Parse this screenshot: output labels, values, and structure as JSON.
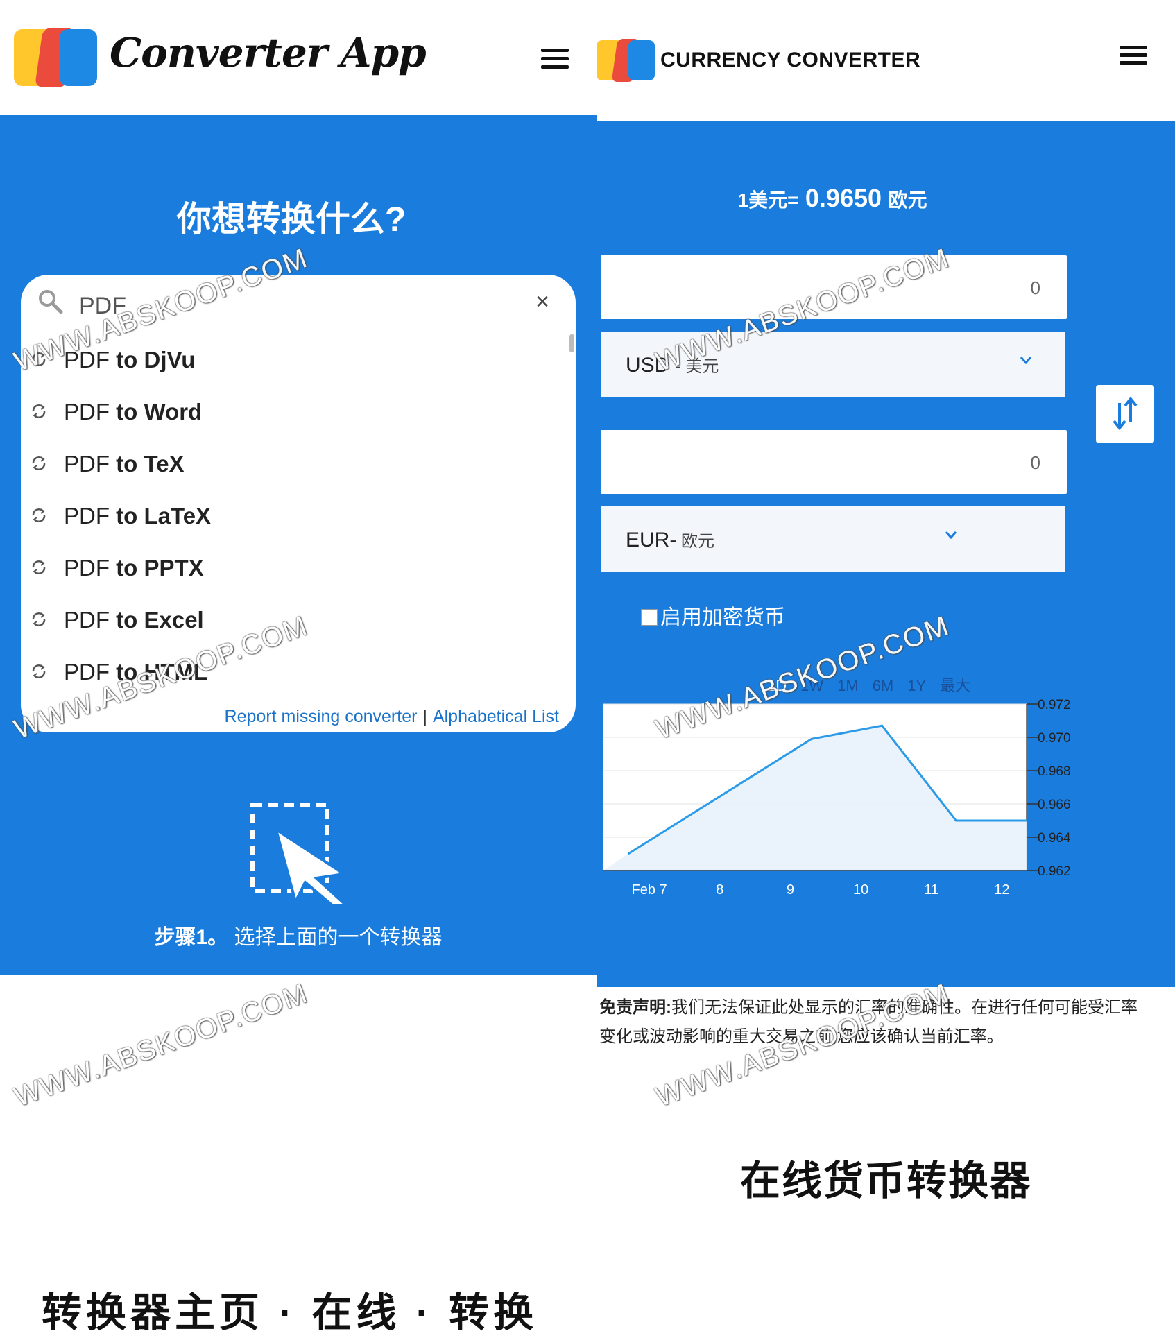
{
  "left_panel": {
    "brand": "Converter App",
    "question": "你想转换什么?",
    "search": {
      "value": "PDF",
      "clear_symbol": "×"
    },
    "results": [
      {
        "source": "PDF ",
        "target": "to DjVu"
      },
      {
        "source": "PDF ",
        "target": "to Word"
      },
      {
        "source": "PDF ",
        "target": "to TeX"
      },
      {
        "source": "PDF ",
        "target": "to LaTeX"
      },
      {
        "source": "PDF ",
        "target": "to PPTX"
      },
      {
        "source": "PDF ",
        "target": "to Excel"
      },
      {
        "source": "PDF ",
        "target": "to HTML"
      }
    ],
    "links": {
      "report": "Report missing converter",
      "separator": "|",
      "alphabetical": "Alphabetical List"
    },
    "step": {
      "label": "步骤1。",
      "text": "选择上面的一个转换器"
    },
    "bottom_heading_partial": "转换器主页 · 在线 · 转换"
  },
  "right_panel": {
    "title": "CURRENCY CONVERTER",
    "rate": {
      "prefix": "1美元=",
      "value": "0.9650",
      "suffix": "欧元"
    },
    "amount_from": "0",
    "amount_to": "0",
    "from_currency": {
      "code": "USD",
      "name": "- 美元"
    },
    "to_currency": {
      "code": "EUR-",
      "name": " 欧元"
    },
    "crypto_label": "启用加密货币",
    "ranges": [
      "1D",
      "1W",
      "1M",
      "6M",
      "1Y",
      "最大"
    ],
    "disclaimer_label": "免责声明:",
    "disclaimer_text": "我们无法保证此处显示的汇率的准确性。在进行任何可能受汇率变化或波动影响的重大交易之前,您应该确认当前汇率。",
    "heading": "在线货币转换器"
  },
  "watermark": "WWW.ABSKOOP.COM",
  "colors": {
    "primary_blue": "#1a7ddd",
    "link_blue": "#1a73c9",
    "chart_line": "#2b9be8",
    "chart_fill": "#e8f2fb"
  },
  "chart_data": {
    "type": "area",
    "x": [
      "Feb 7",
      "8",
      "9",
      "10",
      "11",
      "12"
    ],
    "y_ticks": [
      "0.972",
      "0.970",
      "0.968",
      "0.966",
      "0.964",
      "0.962"
    ],
    "ylim": [
      0.962,
      0.972
    ],
    "series": [
      {
        "points": [
          [
            6.7,
            0.963
          ],
          [
            9.3,
            0.9699
          ],
          [
            10.3,
            0.9707
          ],
          [
            11.35,
            0.965
          ],
          [
            12.35,
            0.965
          ]
        ]
      }
    ]
  }
}
